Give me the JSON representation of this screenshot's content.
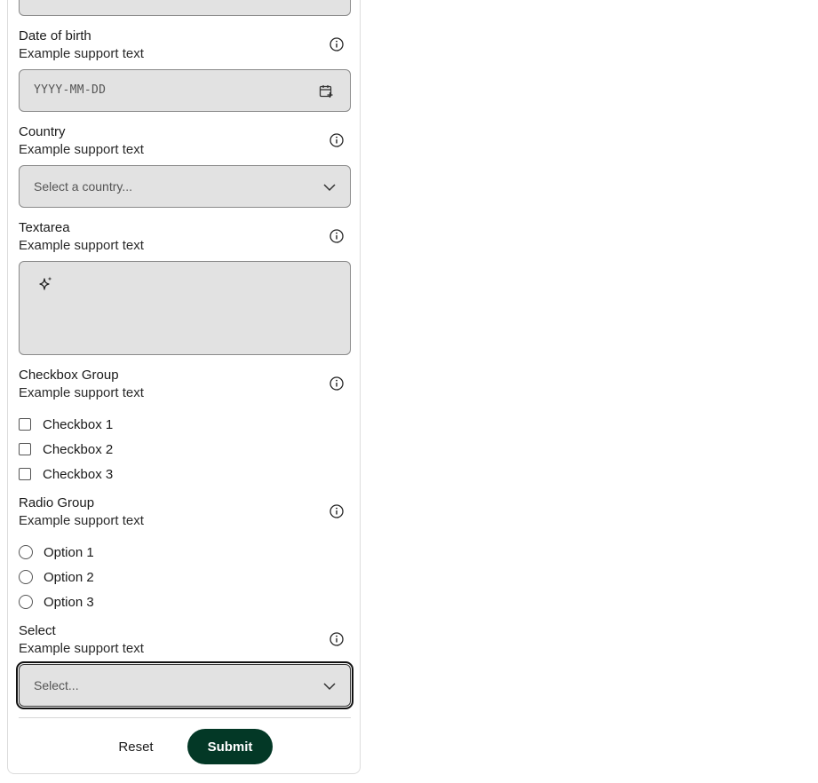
{
  "form": {
    "date_of_birth": {
      "label": "Date of birth",
      "support": "Example support text",
      "placeholder": "YYYY-MM-DD"
    },
    "country": {
      "label": "Country",
      "support": "Example support text",
      "placeholder": "Select a country..."
    },
    "textarea": {
      "label": "Textarea",
      "support": "Example support text"
    },
    "checkbox_group": {
      "label": "Checkbox Group",
      "support": "Example support text",
      "options": [
        "Checkbox 1",
        "Checkbox 2",
        "Checkbox 3"
      ]
    },
    "radio_group": {
      "label": "Radio Group",
      "support": "Example support text",
      "options": [
        "Option 1",
        "Option 2",
        "Option 3"
      ]
    },
    "select": {
      "label": "Select",
      "support": "Example support text",
      "placeholder": "Select..."
    }
  },
  "actions": {
    "reset_label": "Reset",
    "submit_label": "Submit"
  },
  "icons": {
    "info": "info-icon",
    "calendar": "calendar-plus-icon",
    "chevron": "chevron-down-icon",
    "sparkle": "sparkle-icon"
  },
  "colors": {
    "submit_bg": "#033826",
    "field_bg": "#e2e2e2"
  }
}
